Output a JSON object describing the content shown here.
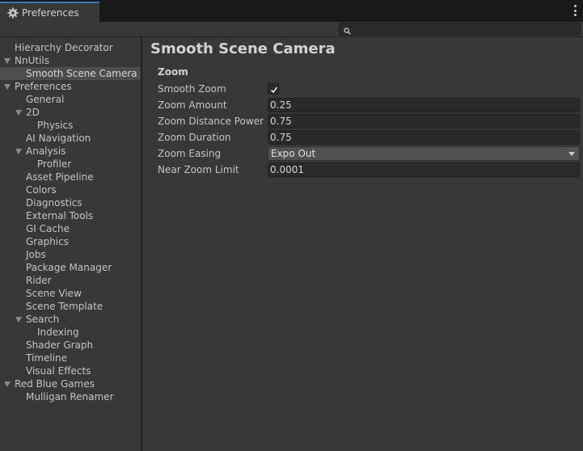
{
  "window": {
    "tab_title": "Preferences",
    "tab_icon": "gear-icon",
    "accent": "#3a79bb"
  },
  "search": {
    "placeholder": "",
    "value": ""
  },
  "sidebar": {
    "items": [
      {
        "label": "Hierarchy Decorator",
        "depth": 0,
        "expandable": false,
        "selected": false
      },
      {
        "label": "NnUtils",
        "depth": 0,
        "expandable": true,
        "selected": false
      },
      {
        "label": "Smooth Scene Camera",
        "depth": 1,
        "expandable": false,
        "selected": true
      },
      {
        "label": "Preferences",
        "depth": 0,
        "expandable": true,
        "selected": false
      },
      {
        "label": "General",
        "depth": 1,
        "expandable": false,
        "selected": false
      },
      {
        "label": "2D",
        "depth": 1,
        "expandable": true,
        "selected": false
      },
      {
        "label": "Physics",
        "depth": 2,
        "expandable": false,
        "selected": false
      },
      {
        "label": "AI Navigation",
        "depth": 1,
        "expandable": false,
        "selected": false
      },
      {
        "label": "Analysis",
        "depth": 1,
        "expandable": true,
        "selected": false
      },
      {
        "label": "Profiler",
        "depth": 2,
        "expandable": false,
        "selected": false
      },
      {
        "label": "Asset Pipeline",
        "depth": 1,
        "expandable": false,
        "selected": false
      },
      {
        "label": "Colors",
        "depth": 1,
        "expandable": false,
        "selected": false
      },
      {
        "label": "Diagnostics",
        "depth": 1,
        "expandable": false,
        "selected": false
      },
      {
        "label": "External Tools",
        "depth": 1,
        "expandable": false,
        "selected": false
      },
      {
        "label": "GI Cache",
        "depth": 1,
        "expandable": false,
        "selected": false
      },
      {
        "label": "Graphics",
        "depth": 1,
        "expandable": false,
        "selected": false
      },
      {
        "label": "Jobs",
        "depth": 1,
        "expandable": false,
        "selected": false
      },
      {
        "label": "Package Manager",
        "depth": 1,
        "expandable": false,
        "selected": false
      },
      {
        "label": "Rider",
        "depth": 1,
        "expandable": false,
        "selected": false
      },
      {
        "label": "Scene View",
        "depth": 1,
        "expandable": false,
        "selected": false
      },
      {
        "label": "Scene Template",
        "depth": 1,
        "expandable": false,
        "selected": false
      },
      {
        "label": "Search",
        "depth": 1,
        "expandable": true,
        "selected": false
      },
      {
        "label": "Indexing",
        "depth": 2,
        "expandable": false,
        "selected": false
      },
      {
        "label": "Shader Graph",
        "depth": 1,
        "expandable": false,
        "selected": false
      },
      {
        "label": "Timeline",
        "depth": 1,
        "expandable": false,
        "selected": false
      },
      {
        "label": "Visual Effects",
        "depth": 1,
        "expandable": false,
        "selected": false
      },
      {
        "label": "Red Blue Games",
        "depth": 0,
        "expandable": true,
        "selected": false
      },
      {
        "label": "Mulligan Renamer",
        "depth": 1,
        "expandable": false,
        "selected": false
      }
    ]
  },
  "main": {
    "title": "Smooth Scene Camera",
    "section": "Zoom",
    "fields": {
      "smooth_zoom": {
        "label": "Smooth Zoom",
        "checked": true
      },
      "zoom_amount": {
        "label": "Zoom Amount",
        "value": "0.25"
      },
      "zoom_distance_power": {
        "label": "Zoom Distance Power",
        "value": "0.75"
      },
      "zoom_duration": {
        "label": "Zoom Duration",
        "value": "0.75"
      },
      "zoom_easing": {
        "label": "Zoom Easing",
        "value": "Expo Out"
      },
      "near_zoom_limit": {
        "label": "Near Zoom Limit",
        "value": "0.0001"
      }
    }
  }
}
